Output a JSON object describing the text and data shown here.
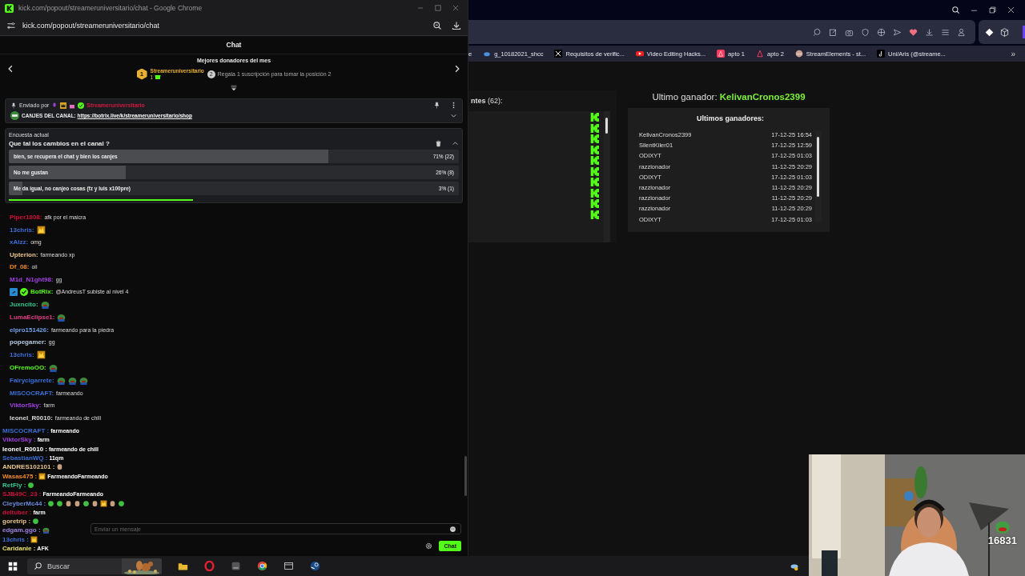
{
  "chat_window": {
    "title": "kick.com/popout/streameruniversitario/chat - Google Chrome",
    "url": "kick.com/popout/streameruniversitario/chat",
    "header": "Chat",
    "donors": {
      "title": "Mejores donadores del mes",
      "rank": "1",
      "name": "Streameruniversitario",
      "count": "1",
      "next_rank": "2",
      "hint": "Regala 1 suscripción para tomar la posición 2"
    },
    "pinned": {
      "label": "Enviado por",
      "sender": "Streameruniversitario",
      "text": "CANJES DEL CANAL:",
      "link": "https://botrix.live/k/streameruniversitario/shop"
    },
    "poll": {
      "label": "Encuesta actual",
      "question": "Que tal los cambios en el canal ?",
      "time_left": {
        "level": 0.41
      },
      "options": [
        {
          "text": "bien, se recupera el chat y bien los canjes",
          "level": 0.71,
          "reading": "71% (22)"
        },
        {
          "text": "No me gustan",
          "level": 0.26,
          "reading": "26% (8)"
        },
        {
          "text": "Me da igual, no canjeo cosas (fz y luis x100pre)",
          "level": 0.03,
          "reading": "3% (1)"
        }
      ]
    },
    "messages": [
      {
        "user": "Piper1808:",
        "color": "#d0103a",
        "text": "afk por el maicra"
      },
      {
        "user": "13chris:",
        "color": "#3b6fd6",
        "emotes": [
          {
            "kind": "cat"
          }
        ]
      },
      {
        "user": "xAlzz:",
        "color": "#3b6fd6",
        "text": "omg"
      },
      {
        "user": "Upterion:",
        "color": "#e8c48a",
        "text": "farmeando xp"
      },
      {
        "user": "Df_08:",
        "color": "#f08a2c",
        "text": "oii"
      },
      {
        "user": "M1d_N1ght98:",
        "color": "#a040e0",
        "text": "gg"
      },
      {
        "user": "BotRix:",
        "color": "#53fc18",
        "bot": true,
        "text": "@AndreusT subiste al nivel 4"
      },
      {
        "user": "Juxncito:",
        "color": "#30c890",
        "emotes": [
          {
            "kind": "frog"
          }
        ]
      },
      {
        "user": "LumaEclipse1:",
        "color": "#e04080",
        "emotes": [
          {
            "kind": "frog"
          }
        ]
      },
      {
        "user": "elpro151426:",
        "color": "#6aa0e8",
        "text": "farmeando para la piedra"
      },
      {
        "user": "popegamer:",
        "color": "#b8c8e0",
        "text": "gg"
      },
      {
        "user": "13chris:",
        "color": "#3b6fd6",
        "emotes": [
          {
            "kind": "cat"
          }
        ]
      },
      {
        "user": "OFremoOO:",
        "color": "#53fc18",
        "emotes": [
          {
            "kind": "frog"
          }
        ]
      },
      {
        "user": "Fairycigarrete:",
        "color": "#3b6fd6",
        "emotes": [
          {
            "kind": "frog"
          },
          {
            "kind": "frog"
          },
          {
            "kind": "frog"
          }
        ]
      },
      {
        "user": "MISCOCRAFT:",
        "color": "#3b6fd6",
        "text": "farmeando"
      },
      {
        "user": "ViktorSky:",
        "color": "#a040e0",
        "text": "farm"
      },
      {
        "user": "leonel_R0010:",
        "color": "#d8d8d8",
        "text": "farmeando de chill"
      }
    ],
    "composer": {
      "placeholder": "Enviar un mensaje",
      "button": "Chat"
    }
  },
  "browser": {
    "bookmarks": [
      {
        "label": "e",
        "kind": "none"
      },
      {
        "label": "g_10182021_shcc",
        "kind": "cloud"
      },
      {
        "label": "Requisitos de verific...",
        "kind": "x"
      },
      {
        "label": "Video Editing Hacks...",
        "kind": "video"
      },
      {
        "label": "apto 1",
        "kind": "stay"
      },
      {
        "label": "apto 2",
        "kind": "stay-outline"
      },
      {
        "label": "StreamElements - st...",
        "kind": "bowl"
      },
      {
        "label": "Uni/Aris (@streame...",
        "kind": "note"
      }
    ],
    "more": "»"
  },
  "raffle": {
    "participants_heading": "**ntes** (62):",
    "winner_label": "Ultimo ganador:",
    "winner": "KelivanCronos2399",
    "history_title": "Ultimos ganadores:",
    "history": [
      {
        "name": "KelivanCronos2399",
        "date": "17-12-25 16:54"
      },
      {
        "name": "SilentKiler01",
        "date": "17-12-25 12:59"
      },
      {
        "name": "ODIXYT",
        "date": "17-12-25 01:03"
      },
      {
        "name": "razzionador",
        "date": "11-12-25 20:29"
      },
      {
        "name": "ODIXYT",
        "date": "17-12-25 01:03"
      },
      {
        "name": "razzionador",
        "date": "11-12-25 20:29"
      },
      {
        "name": "razzionador",
        "date": "11-12-25 20:29"
      },
      {
        "name": "razzionador",
        "date": "11-12-25 20:29"
      },
      {
        "name": "ODIXYT",
        "date": "17-12-25 01:03"
      }
    ]
  },
  "stream_overlay": {
    "counter": "16831",
    "messages": [
      {
        "user": "MISCOCRAFT :",
        "color": "#3b6fd6",
        "text": "farmeando"
      },
      {
        "user": "ViktorSky :",
        "color": "#a040e0",
        "text": "farm"
      },
      {
        "user": "leonel_R0010 :",
        "color": "#ffffff",
        "text": "farmeando de chill"
      },
      {
        "user": "SebastianWQ :",
        "color": "#3b6fd6",
        "text": "11qm"
      },
      {
        "user": "ANDRES102101 :",
        "color": "#e8c48a",
        "emotes": [
          {
            "kind": "face"
          }
        ]
      },
      {
        "user": "Wasas475 :",
        "color": "#f08a2c",
        "emotes": [
          {
            "kind": "cat"
          }
        ],
        "text": "FarmeandoFarmeando"
      },
      {
        "user": "RetFly :",
        "color": "#30c890",
        "emotes": [
          {
            "kind": "blob"
          }
        ]
      },
      {
        "user": "SJB49C_23 :",
        "color": "#d0103a",
        "text": "FarmeandoFarmeando"
      },
      {
        "user": "CleyberMc44 :",
        "color": "#6a8ad8",
        "emotes": [
          {
            "kind": "blob"
          },
          {
            "kind": "blob"
          },
          {
            "kind": "face"
          },
          {
            "kind": "face"
          },
          {
            "kind": "blob"
          },
          {
            "kind": "face"
          },
          {
            "kind": "cat"
          },
          {
            "kind": "face"
          },
          {
            "kind": "blob"
          }
        ]
      },
      {
        "user": "deltuber :",
        "color": "#d0103a",
        "text": "farm"
      },
      {
        "user": "goretrip :",
        "color": "#e8c48a",
        "emotes": [
          {
            "kind": "blob"
          }
        ]
      },
      {
        "user": "edgam.ggo :",
        "color": "#a080e0",
        "emotes": [
          {
            "kind": "frog"
          }
        ]
      },
      {
        "user": "13chris :",
        "color": "#3b6fd6",
        "emotes": [
          {
            "kind": "cat"
          }
        ]
      },
      {
        "user": "Caridanie :",
        "color": "#e8e070",
        "text": "AFK"
      }
    ]
  },
  "taskbar": {
    "search": "Buscar"
  }
}
